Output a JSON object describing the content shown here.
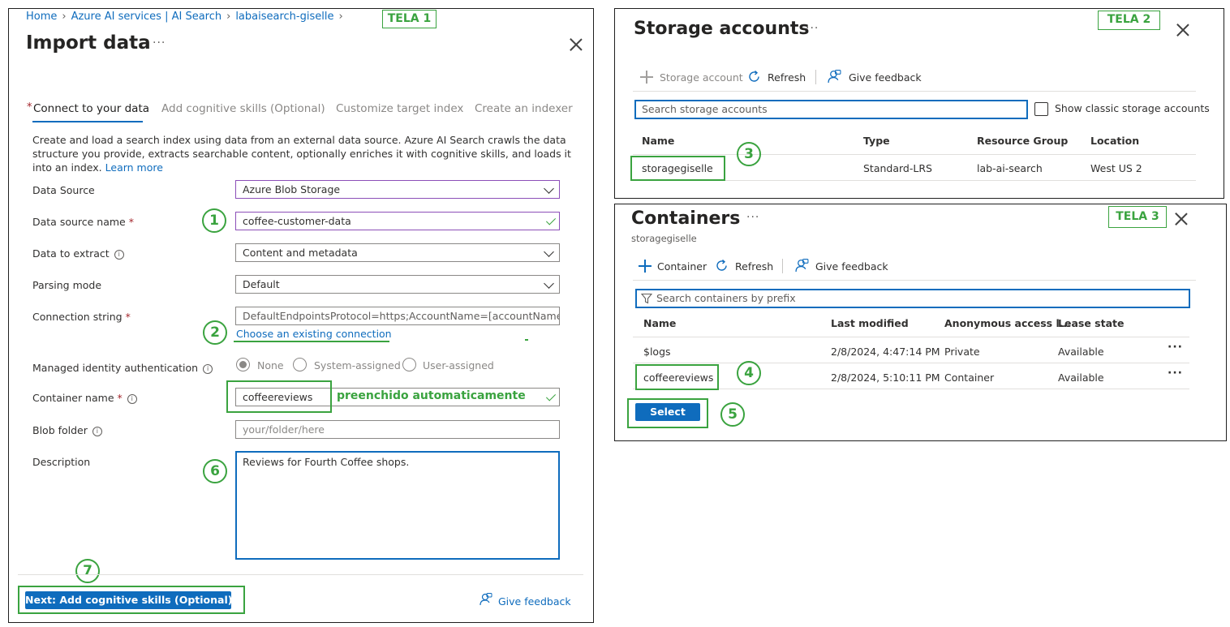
{
  "screen1": {
    "tela_label": "TELA 1",
    "breadcrumb": [
      "Home",
      "Azure AI services | AI Search",
      "labaisearch-giselle"
    ],
    "title": "Import data",
    "tabs": [
      "Connect to your data",
      "Add cognitive skills (Optional)",
      "Customize target index",
      "Create an indexer"
    ],
    "description": "Create and load a search index using data from an external data source. Azure AI Search crawls the data structure you provide, extracts searchable content, optionally enriches it with cognitive skills, and loads it into an index.",
    "learn_more": "Learn more",
    "fields": {
      "data_source": {
        "label": "Data Source",
        "value": "Azure Blob Storage"
      },
      "data_source_name": {
        "label": "Data source name",
        "value": "coffee-customer-data"
      },
      "data_to_extract": {
        "label": "Data to extract",
        "value": "Content and metadata"
      },
      "parsing_mode": {
        "label": "Parsing mode",
        "value": "Default"
      },
      "connection_string": {
        "label": "Connection string",
        "value": "DefaultEndpointsProtocol=https;AccountName=[accountName];..."
      },
      "choose_connection": "Choose an existing connection",
      "managed_identity": {
        "label": "Managed identity authentication",
        "options": [
          "None",
          "System-assigned",
          "User-assigned"
        ],
        "selected": "None"
      },
      "container_name": {
        "label": "Container name",
        "value": "coffeereviews",
        "note": "preenchido automaticamente"
      },
      "blob_folder": {
        "label": "Blob folder",
        "placeholder": "your/folder/here"
      },
      "description": {
        "label": "Description",
        "value": "Reviews for Fourth Coffee shops."
      }
    },
    "next_button": "Next: Add cognitive skills (Optional)",
    "give_feedback": "Give feedback",
    "steps": [
      "1",
      "2",
      "6",
      "7"
    ]
  },
  "screen2": {
    "tela_label": "TELA 2",
    "title": "Storage accounts",
    "toolbar": {
      "add": "Storage account",
      "refresh": "Refresh",
      "feedback": "Give feedback"
    },
    "search_placeholder": "Search storage accounts",
    "show_classic": "Show classic storage accounts",
    "columns": [
      "Name",
      "Type",
      "Resource Group",
      "Location"
    ],
    "rows": [
      {
        "name": "storagegiselle",
        "type": "Standard-LRS",
        "resource_group": "lab-ai-search",
        "location": "West US 2"
      }
    ],
    "step": "3"
  },
  "screen3": {
    "tela_label": "TELA 3",
    "title": "Containers",
    "subtitle": "storagegiselle",
    "toolbar": {
      "add": "Container",
      "refresh": "Refresh",
      "feedback": "Give feedback"
    },
    "search_placeholder": "Search containers by prefix",
    "columns": [
      "Name",
      "Last modified",
      "Anonymous access l...",
      "Lease state"
    ],
    "rows": [
      {
        "name": "$logs",
        "modified": "2/8/2024, 4:47:14 PM",
        "access": "Private",
        "lease": "Available"
      },
      {
        "name": "coffeereviews",
        "modified": "2/8/2024, 5:10:11 PM",
        "access": "Container",
        "lease": "Available"
      }
    ],
    "select_button": "Select",
    "steps": [
      "4",
      "5"
    ]
  },
  "colors": {
    "accent": "#0f6cbd",
    "annotation": "#3aa33f",
    "purple_border": "#8c4fb8"
  }
}
